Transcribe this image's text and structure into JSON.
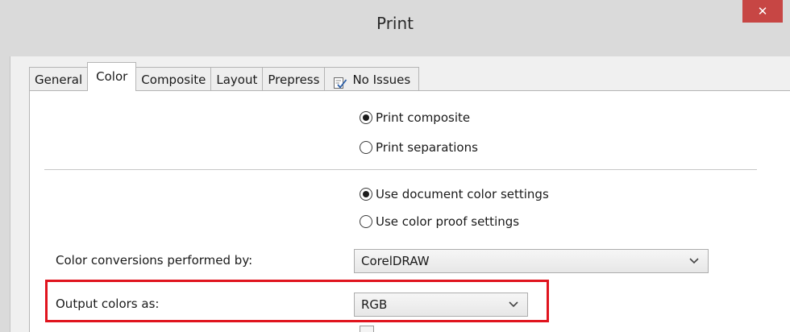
{
  "window": {
    "title": "Print",
    "close_label": "✕"
  },
  "tabs": [
    {
      "label": "General",
      "active": false
    },
    {
      "label": "Color",
      "active": true
    },
    {
      "label": "Composite",
      "active": false
    },
    {
      "label": "Layout",
      "active": false
    },
    {
      "label": "Prepress",
      "active": false
    },
    {
      "label": "No Issues",
      "active": false,
      "icon": "issues-checklist-icon"
    }
  ],
  "print_mode": {
    "options": [
      {
        "label": "Print composite",
        "checked": true
      },
      {
        "label": "Print separations",
        "checked": false
      }
    ]
  },
  "color_settings": {
    "options": [
      {
        "label": "Use document color settings",
        "checked": true
      },
      {
        "label": "Use color proof settings",
        "checked": false
      }
    ]
  },
  "conversions": {
    "label": "Color conversions performed by:",
    "value": "CorelDRAW"
  },
  "output": {
    "label": "Output colors as:",
    "value": "RGB"
  },
  "colors": {
    "close_button": "#c74644",
    "highlight": "#e0141e"
  }
}
